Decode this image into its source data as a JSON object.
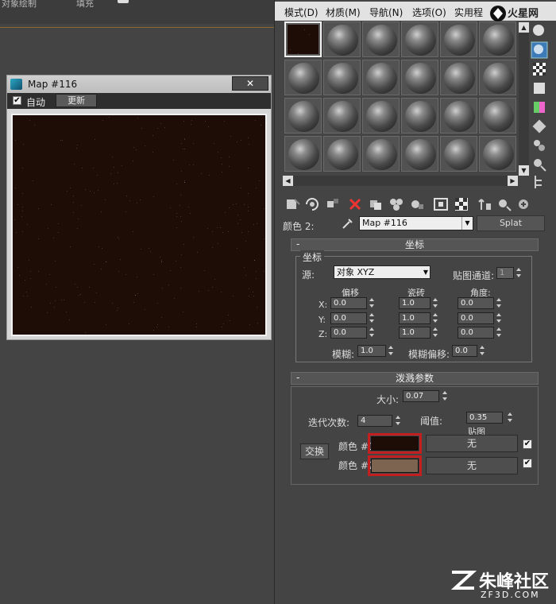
{
  "background_top": {
    "item1": "对象绘制",
    "item2": "填充"
  },
  "map_window": {
    "title": "Map #116",
    "close_symbol": "✕",
    "auto_label": "自动",
    "auto_checked": "✔",
    "update_button": "更新"
  },
  "editor": {
    "menu": [
      "模式(D)",
      "材质(M)",
      "导航(N)",
      "选项(O)",
      "实用程"
    ],
    "logo_text": "火星网",
    "toolbar_color_label": "颜色 2:",
    "map_name": "Map #116",
    "splat_button": "Splat",
    "coords": {
      "rollout_title": "坐标",
      "group_label": "坐标",
      "source_label": "源:",
      "source_value": "对象 XYZ",
      "map_channel_label": "贴图通道:",
      "map_channel_value": "1",
      "col_offset": "偏移",
      "col_tiling": "瓷砖",
      "col_angle": "角度:",
      "rows": [
        {
          "axis": "X:",
          "offset": "0.0",
          "tiling": "1.0",
          "angle": "0.0"
        },
        {
          "axis": "Y:",
          "offset": "0.0",
          "tiling": "1.0",
          "angle": "0.0"
        },
        {
          "axis": "Z:",
          "offset": "0.0",
          "tiling": "1.0",
          "angle": "0.0"
        }
      ],
      "blur_label": "模糊:",
      "blur_value": "1.0",
      "blur_offset_label": "模糊偏移:",
      "blur_offset_value": "0.0"
    },
    "splat": {
      "rollout_title": "泼溅参数",
      "size_label": "大小:",
      "size_value": "0.07",
      "iterations_label": "迭代次数:",
      "iterations_value": "4",
      "threshold_label": "阈值:",
      "threshold_value": "0.35",
      "maps_label": "贴图",
      "swap_button": "交换",
      "color1_label": "颜色 #1",
      "color2_label": "颜色 #2",
      "color1_hex": "#1e0d07",
      "color2_hex": "#7c6450",
      "map1": "无",
      "map2": "无",
      "check_symbol": "✔"
    }
  },
  "watermark": {
    "big": "朱峰社区",
    "small": "ZF3D.COM"
  }
}
